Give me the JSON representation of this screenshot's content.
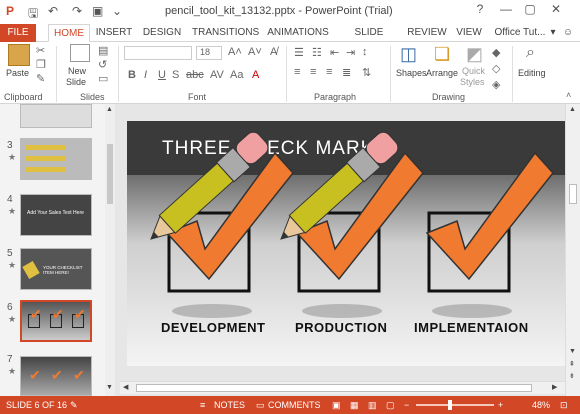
{
  "titlebar": {
    "title": "pencil_tool_kit_13132.pptx - PowerPoint (Trial)",
    "help": "?",
    "minimize": "—",
    "restore": "▢",
    "close": "✕"
  },
  "tabs": [
    "FILE",
    "HOME",
    "INSERT",
    "DESIGN",
    "TRANSITIONS",
    "ANIMATIONS",
    "SLIDE SHOW",
    "REVIEW",
    "VIEW",
    "Office Tut..."
  ],
  "ribbon": {
    "paste": "Paste",
    "clipboard": "Clipboard",
    "new_slide_1": "New",
    "new_slide_2": "Slide",
    "slides": "Slides",
    "font_size": "18",
    "font": "Font",
    "paragraph": "Paragraph",
    "shapes": "Shapes",
    "arrange": "Arrange",
    "quick_styles_1": "Quick",
    "quick_styles_2": "Styles",
    "drawing": "Drawing",
    "editing": "Editing"
  },
  "thumbnails": [
    {
      "num": "3",
      "star": "★"
    },
    {
      "num": "4",
      "star": "★"
    },
    {
      "num": "5",
      "star": "★"
    },
    {
      "num": "6",
      "star": "★"
    },
    {
      "num": "7",
      "star": "★"
    }
  ],
  "thumb_texts": {
    "t4": "Add Your Sales Text Here",
    "t5": "YOUR CHECKLIST ITEM HERE!"
  },
  "slide": {
    "title": "THREE CHECK MARKS",
    "labels": [
      "DEVELOPMENT",
      "PRODUCTION",
      "IMPLEMENTAION"
    ]
  },
  "status": {
    "slide": "SLIDE 6 OF 16",
    "notes": "NOTES",
    "comments": "COMMENTS",
    "zoom": "48%"
  },
  "colors": {
    "accent": "#d24726",
    "check": "#ef7a30",
    "pencil": "#c8c020"
  }
}
